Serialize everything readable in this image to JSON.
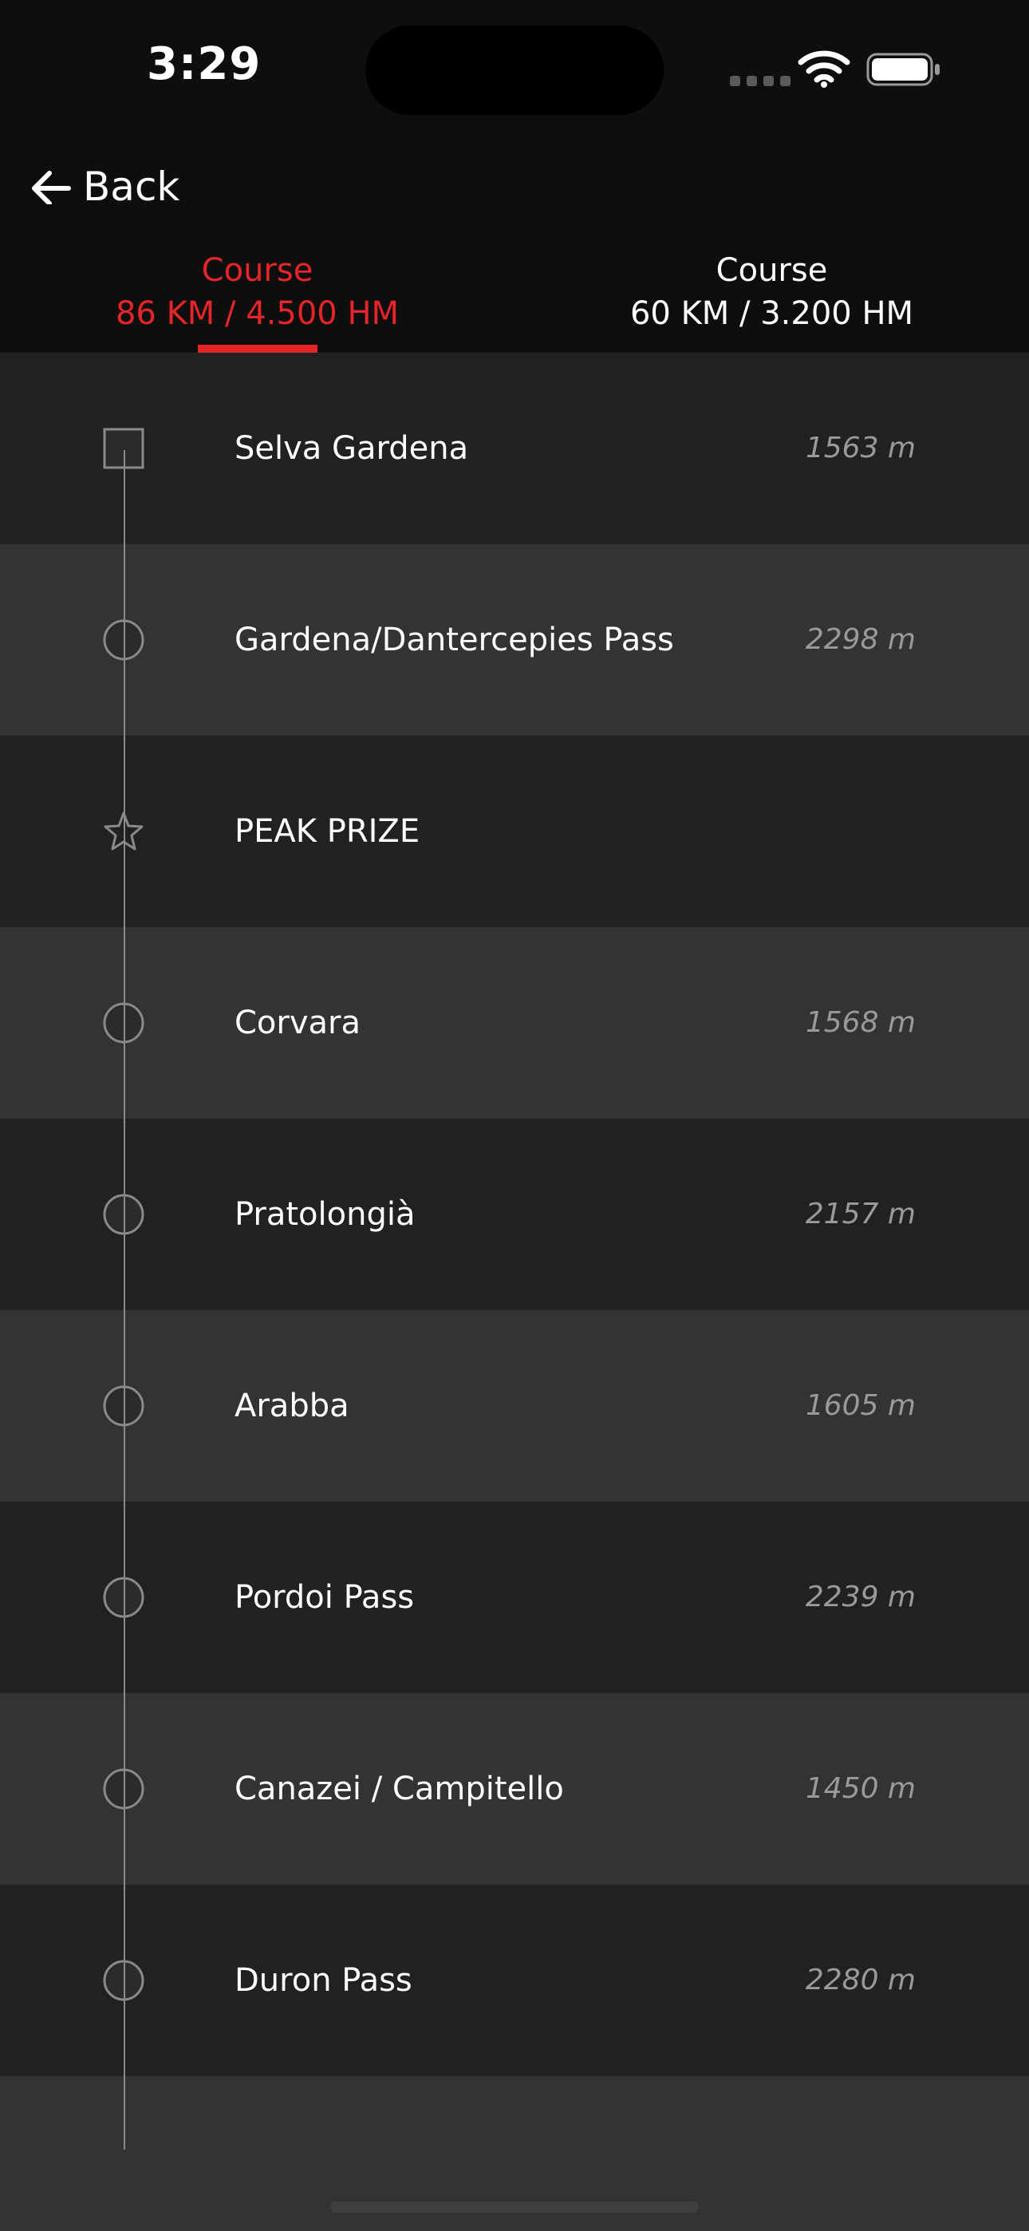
{
  "status_bar": {
    "time": "3:29"
  },
  "nav": {
    "back_label": "Back"
  },
  "tabs": [
    {
      "title": "Course",
      "subtitle": "86 KM / 4.500 HM",
      "active": true
    },
    {
      "title": "Course",
      "subtitle": "60 KM / 3.200 HM",
      "active": false
    }
  ],
  "stops": [
    {
      "name": "Selva Gardena",
      "elevation": "1563 m",
      "marker": "square-icon"
    },
    {
      "name": "Gardena/Dantercepies Pass",
      "elevation": "2298 m",
      "marker": "circle-icon"
    },
    {
      "name": "PEAK PRIZE",
      "elevation": "",
      "marker": "star-icon"
    },
    {
      "name": "Corvara",
      "elevation": "1568 m",
      "marker": "circle-icon"
    },
    {
      "name": "Pratolongià",
      "elevation": "2157 m",
      "marker": "circle-icon"
    },
    {
      "name": "Arabba",
      "elevation": "1605 m",
      "marker": "circle-icon"
    },
    {
      "name": "Pordoi Pass",
      "elevation": "2239 m",
      "marker": "circle-icon"
    },
    {
      "name": "Canazei / Campitello",
      "elevation": "1450 m",
      "marker": "circle-icon"
    },
    {
      "name": "Duron Pass",
      "elevation": "2280 m",
      "marker": "circle-icon"
    }
  ],
  "colors": {
    "accent": "#e5252a",
    "header_bg": "#0e0e0e",
    "row_dark": "#212121",
    "row_light": "#333333",
    "timeline": "#8a8a8a"
  }
}
